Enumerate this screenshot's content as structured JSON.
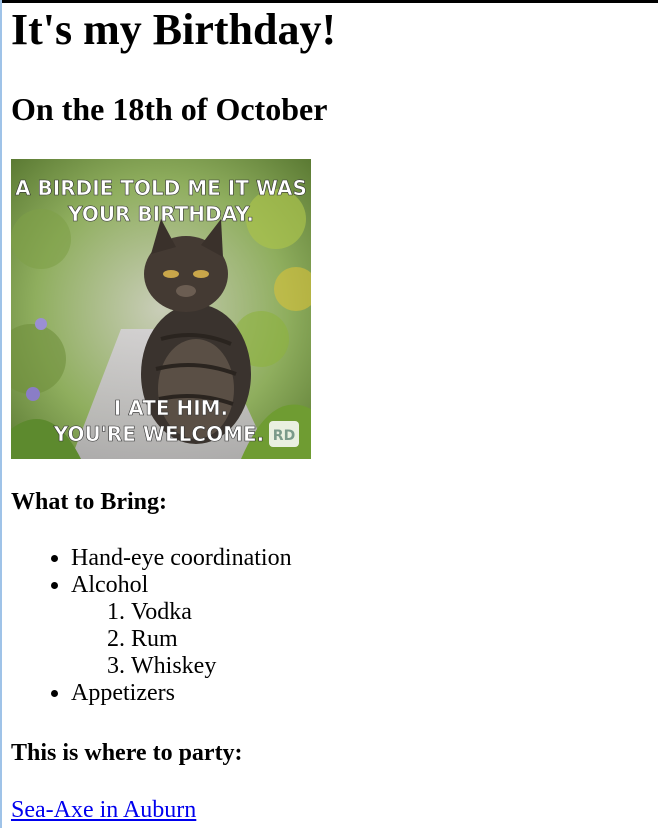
{
  "page": {
    "title": "It's my Birthday!",
    "date_heading": "On the 18th of October",
    "meme": {
      "top_text_line1": "A BIRDIE TOLD ME IT WAS",
      "top_text_line2": "YOUR BIRTHDAY.",
      "bottom_text_line1": "I ATE HIM.",
      "bottom_text_line2": "YOU'RE WELCOME.",
      "watermark": "RD"
    },
    "bring_heading": "What to Bring:",
    "bring_items": [
      "Hand-eye coordination",
      "Alcohol",
      "Appetizers"
    ],
    "alcohol_items": [
      "Vodka",
      "Rum",
      "Whiskey"
    ],
    "party_heading": "This is where to party:",
    "venue_link": "Sea-Axe in Auburn"
  },
  "colors": {
    "link": "#0000ee",
    "top_border": "#000000",
    "left_border": "#9fc3e8"
  }
}
